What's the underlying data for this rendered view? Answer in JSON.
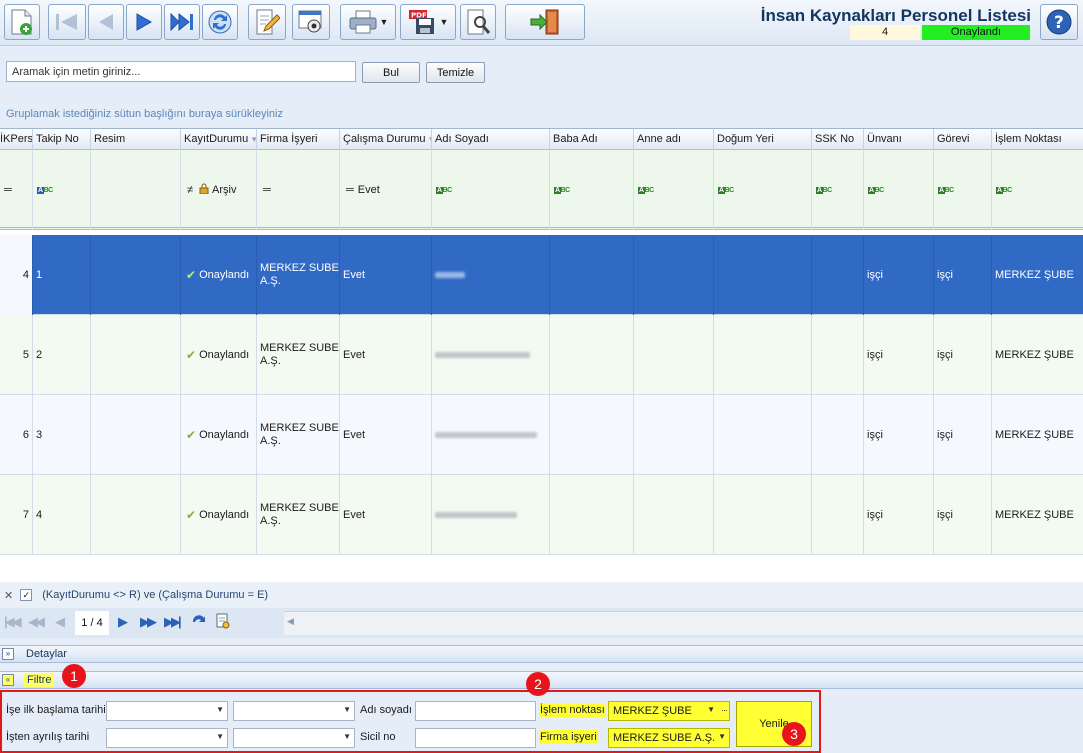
{
  "header": {
    "title": "İnsan Kaynakları Personel Listesi",
    "record_count": "4",
    "status": "Onaylandı",
    "status_color": "#22ee22"
  },
  "toolbar": {
    "icons": [
      "new-record-icon",
      "first-record-icon",
      "previous-record-icon",
      "next-record-icon",
      "last-record-icon",
      "refresh-icon",
      "edit-icon",
      "preview-icon",
      "print-icon",
      "pdf-export-icon",
      "tools-icon",
      "exit-icon"
    ],
    "help_icon": "help-icon"
  },
  "search": {
    "placeholder": "Aramak için metin giriniz...",
    "find_label": "Bul",
    "clear_label": "Temizle"
  },
  "grid": {
    "group_hint": "Gruplamak istediğiniz sütun başlığını buraya sürükleyiniz",
    "columns": [
      "İKPers",
      "Takip No",
      "Resim",
      "KayıtDurumu",
      "Firma İşyeri",
      "Çalışma Durumu",
      "Adı Soyadı",
      "Baba Adı",
      "Anne adı",
      "Doğum Yeri",
      "SSK No",
      "Ünvanı",
      "Görevi",
      "İşlem Noktası"
    ],
    "filter_row": {
      "ikpers_op": "═",
      "kayit_op": "≠",
      "kayit_value": "Arşiv",
      "firma_op": "═",
      "calisma_op": "═",
      "calisma_value": "Evet",
      "text_marker": "ABC"
    },
    "rows": [
      {
        "ikpers": "4",
        "takip": "1",
        "kayit": "Onaylandı",
        "firma": "MERKEZ SUBE A.Ş.",
        "calisma": "Evet",
        "unvan": "işçi",
        "gorev": "işçi",
        "islem": "MERKEZ ŞUBE"
      },
      {
        "ikpers": "5",
        "takip": "2",
        "kayit": "Onaylandı",
        "firma": "MERKEZ SUBE A.Ş.",
        "calisma": "Evet",
        "unvan": "işçi",
        "gorev": "işçi",
        "islem": "MERKEZ ŞUBE"
      },
      {
        "ikpers": "6",
        "takip": "3",
        "kayit": "Onaylandı",
        "firma": "MERKEZ SUBE A.Ş.",
        "calisma": "Evet",
        "unvan": "işçi",
        "gorev": "işçi",
        "islem": "MERKEZ ŞUBE"
      },
      {
        "ikpers": "7",
        "takip": "4",
        "kayit": "Onaylandı",
        "firma": "MERKEZ SUBE A.Ş.",
        "calisma": "Evet",
        "unvan": "işçi",
        "gorev": "işçi",
        "islem": "MERKEZ ŞUBE"
      }
    ],
    "filter_expression": "(KayıtDurumu <> R) ve (Çalışma Durumu = E)",
    "selected_color": "#316ac5"
  },
  "navigator": {
    "page": "1 / 4"
  },
  "panels": {
    "details_label": "Detaylar",
    "filter_label": "Filtre"
  },
  "filter_panel": {
    "start_date_label": "İşe ilk başlama tarihi",
    "leave_date_label": "İşten ayrılış tarihi",
    "name_label": "Adı soyadı",
    "sicil_label": "Sicil no",
    "islem_label": "İşlem noktası",
    "islem_value": "MERKEZ ŞUBE",
    "firma_label": "Firma işyeri",
    "firma_value": "MERKEZ SUBE A.Ş.",
    "refresh_label": "Yenile",
    "highlight_color": "#ffff33"
  },
  "callouts": [
    "1",
    "2",
    "3"
  ],
  "callout_color": "#e8141c"
}
